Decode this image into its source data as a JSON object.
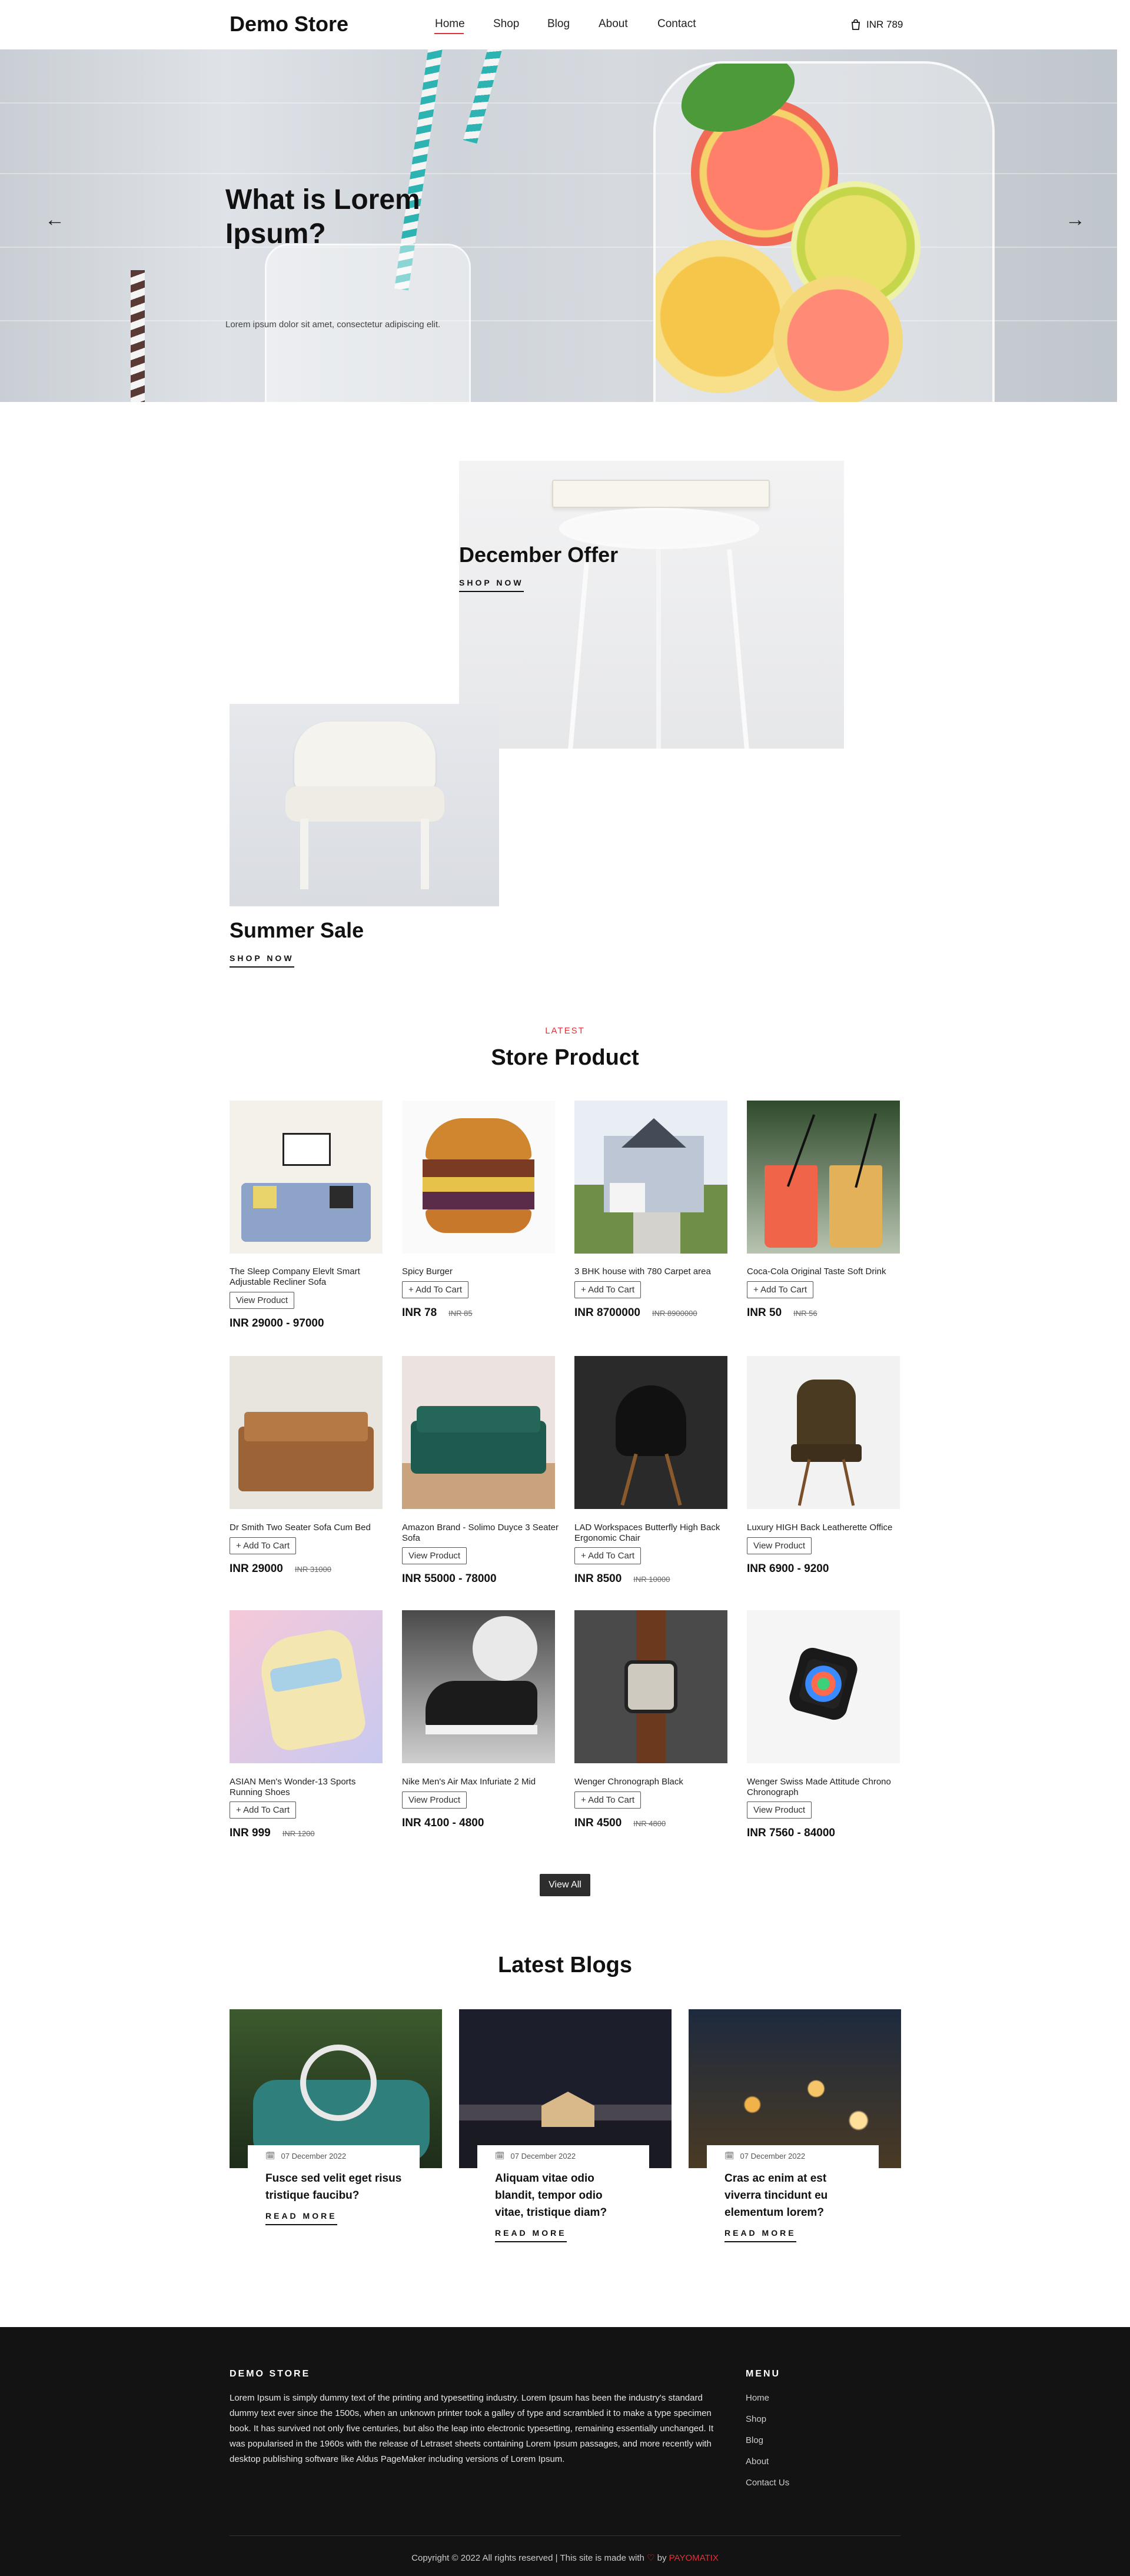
{
  "header": {
    "logo": "Demo Store",
    "nav": [
      {
        "label": "Home",
        "active": true
      },
      {
        "label": "Shop"
      },
      {
        "label": "Blog"
      },
      {
        "label": "About"
      },
      {
        "label": "Contact"
      }
    ],
    "cart_total": "INR 789",
    "cart_icon": "shopping-bag-icon"
  },
  "hero": {
    "title": "What is Lorem Ipsum?",
    "subtitle": "Lorem ipsum dolor sit amet, consectetur adipiscing elit.",
    "prev_icon": "arrow-left-icon",
    "next_icon": "arrow-right-icon"
  },
  "offers": [
    {
      "title": "December Offer",
      "cta": "SHOP NOW"
    },
    {
      "title": "Summer Sale",
      "cta": "SHOP NOW"
    }
  ],
  "products_section": {
    "eyebrow": "LATEST",
    "title": "Store Product",
    "view_all": "View All",
    "products": [
      {
        "name": "The Sleep Company Elevlt Smart Adjustable Recliner Sofa",
        "button": "View Product",
        "price": "INR 29000 - 97000",
        "old_price": ""
      },
      {
        "name": "Spicy Burger",
        "button": "+ Add To Cart",
        "price": "INR 78",
        "old_price": "INR 85"
      },
      {
        "name": "3 BHK house with 780 Carpet area",
        "button": "+ Add To Cart",
        "price": "INR 8700000",
        "old_price": "INR 8900000"
      },
      {
        "name": "Coca-Cola Original Taste Soft Drink",
        "button": "+ Add To Cart",
        "price": "INR 50",
        "old_price": "INR 56"
      },
      {
        "name": "Dr Smith Two Seater Sofa Cum Bed",
        "button": "+ Add To Cart",
        "price": "INR 29000",
        "old_price": "INR 31000"
      },
      {
        "name": "Amazon Brand - Solimo Duyce 3 Seater Sofa",
        "button": "View Product",
        "price": "INR 55000 - 78000",
        "old_price": ""
      },
      {
        "name": "LAD Workspaces Butterfly High Back Ergonomic Chair",
        "button": "+ Add To Cart",
        "price": "INR 8500",
        "old_price": "INR 10000"
      },
      {
        "name": "Luxury HIGH Back Leatherette Office",
        "button": "View Product",
        "price": "INR 6900 - 9200",
        "old_price": ""
      },
      {
        "name": "ASIAN Men's Wonder-13 Sports Running Shoes",
        "button": "+ Add To Cart",
        "price": "INR 999",
        "old_price": "INR 1200"
      },
      {
        "name": "Nike Men's Air Max Infuriate 2 Mid",
        "button": "View Product",
        "price": "INR 4100 - 4800",
        "old_price": ""
      },
      {
        "name": "Wenger Chronograph Black",
        "button": "+ Add To Cart",
        "price": "INR 4500",
        "old_price": "INR 4800"
      },
      {
        "name": "Wenger Swiss Made Attitude Chrono Chronograph",
        "button": "View Product",
        "price": "INR 7560 - 84000",
        "old_price": ""
      }
    ]
  },
  "blogs_section": {
    "title": "Latest Blogs",
    "posts": [
      {
        "date": "07 December 2022",
        "title": "Fusce sed velit eget risus tristique faucibu?",
        "cta": "READ MORE"
      },
      {
        "date": "07 December 2022",
        "title": "Aliquam vitae odio blandit, tempor odio vitae, tristique diam?",
        "cta": "READ MORE"
      },
      {
        "date": "07 December 2022",
        "title": "Cras ac enim at est viverra tincidunt eu elementum lorem?",
        "cta": "READ MORE"
      }
    ],
    "date_icon": "calendar-icon"
  },
  "footer": {
    "store_heading": "DEMO STORE",
    "store_text": "Lorem Ipsum is simply dummy text of the printing and typesetting industry. Lorem Ipsum has been the industry's standard dummy text ever since the 1500s, when an unknown printer took a galley of type and scrambled it to make a type specimen book. It has survived not only five centuries, but also the leap into electronic typesetting, remaining essentially unchanged. It was popularised in the 1960s with the release of Letraset sheets containing Lorem Ipsum passages, and more recently with desktop publishing software like Aldus PageMaker including versions of Lorem Ipsum.",
    "menu_heading": "MENU",
    "menu": [
      "Home",
      "Shop",
      "Blog",
      "About",
      "Contact Us"
    ],
    "copyright": "Copyright © 2022 All rights reserved | This site is made with",
    "by": "by",
    "brand": "PAYOMATIX",
    "heart_icon": "heart-icon"
  },
  "colors": {
    "accent": "#e0313a",
    "footer_bg": "#131313",
    "dark_button": "#2d2d2d"
  }
}
